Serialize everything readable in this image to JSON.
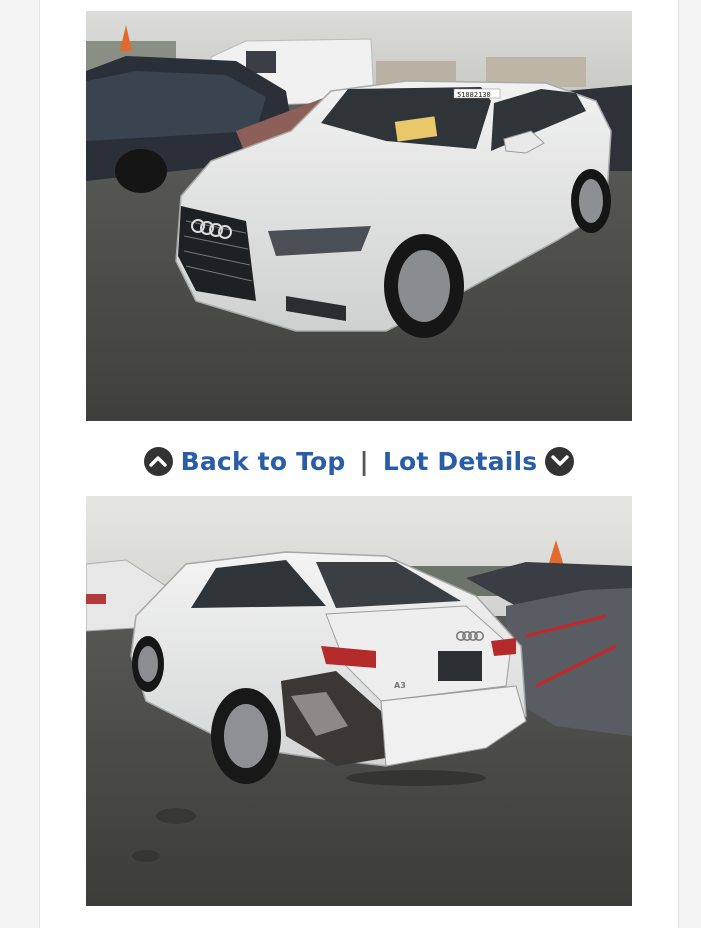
{
  "photos": [
    {
      "alt": "Front view of a white Audi A3 sedan in a salvage lot",
      "lot_tag": "51882130"
    },
    {
      "alt": "Rear view of a white Audi A3 sedan with damaged rear bumper",
      "badge": "A3"
    }
  ],
  "nav": {
    "back_to_top_label": "Back to Top",
    "separator": "|",
    "lot_details_label": "Lot Details",
    "up_icon": "chevron-up-circle-icon",
    "down_icon": "chevron-down-circle-icon"
  },
  "colors": {
    "link": "#2a5da8",
    "icon_circle": "#333333",
    "page_bg": "#f4f4f4"
  }
}
